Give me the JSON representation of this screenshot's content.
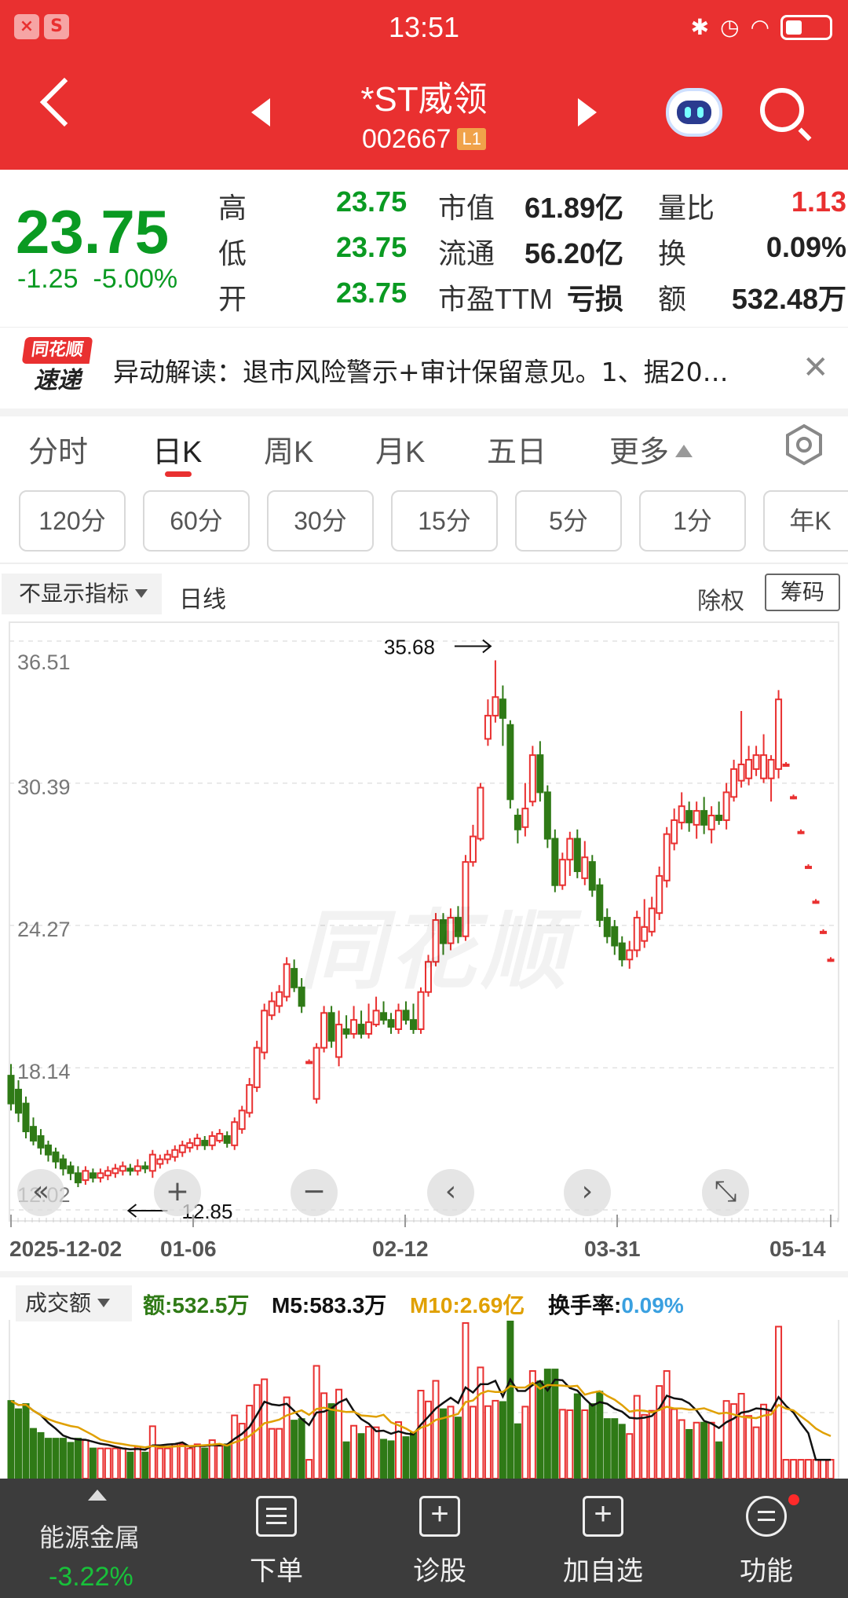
{
  "status_bar": {
    "time": "13:51"
  },
  "header": {
    "stock_name": "*ST威领",
    "stock_code": "002667",
    "level_badge": "L1"
  },
  "quote": {
    "price": "23.75",
    "change_abs": "-1.25",
    "change_pct": "-5.00%",
    "rows": [
      {
        "l1": "高",
        "v1": "23.75",
        "l2": "市值",
        "v2": "61.89亿",
        "l3": "量比",
        "v3": "1.13"
      },
      {
        "l1": "低",
        "v1": "23.75",
        "l2": "流通",
        "v2": "56.20亿",
        "l3": "换",
        "v3": "0.09%"
      },
      {
        "l1": "开",
        "v1": "23.75",
        "l2": "市盈TTM",
        "v2": "亏损",
        "l3": "额",
        "v3": "532.48万"
      }
    ]
  },
  "news": {
    "logo_top": "同花顺",
    "logo_bottom": "速递",
    "text": "异动解读：退市风险警示+审计保留意见。1、据20…"
  },
  "tabs": [
    {
      "label": "分时"
    },
    {
      "label": "日K"
    },
    {
      "label": "周K"
    },
    {
      "label": "月K"
    },
    {
      "label": "五日"
    },
    {
      "label": "更多"
    }
  ],
  "periods": [
    "120分",
    "60分",
    "30分",
    "15分",
    "5分",
    "1分",
    "年K"
  ],
  "chart_header": {
    "indicator": "不显示指标",
    "line_type": "日线",
    "adjust": "除权",
    "chips": "筹码"
  },
  "chart_data": {
    "type": "candlestick",
    "y_axis_labels": [
      "36.51",
      "30.39",
      "24.27",
      "18.14",
      "12.02"
    ],
    "ylim": [
      12.02,
      36.51
    ],
    "max_marker": "35.68",
    "min_marker": "12.85",
    "x_tick_labels": [
      "2025-12-02",
      "01-06",
      "02-12",
      "03-31",
      "05-14"
    ],
    "candles": [
      {
        "o": 17.8,
        "c": 16.6,
        "h": 18.3,
        "l": 16.3
      },
      {
        "o": 17.2,
        "c": 16.2,
        "h": 17.6,
        "l": 15.8
      },
      {
        "o": 16.6,
        "c": 15.4,
        "h": 16.9,
        "l": 15.1
      },
      {
        "o": 15.6,
        "c": 15.0,
        "h": 16.0,
        "l": 14.8
      },
      {
        "o": 15.2,
        "c": 14.7,
        "h": 15.5,
        "l": 14.4
      },
      {
        "o": 14.8,
        "c": 14.4,
        "h": 15.0,
        "l": 14.1
      },
      {
        "o": 14.5,
        "c": 14.1,
        "h": 14.7,
        "l": 13.8
      },
      {
        "o": 14.2,
        "c": 13.8,
        "h": 14.4,
        "l": 13.5
      },
      {
        "o": 13.9,
        "c": 13.6,
        "h": 14.1,
        "l": 13.3
      },
      {
        "o": 13.6,
        "c": 13.2,
        "h": 13.9,
        "l": 13.0
      },
      {
        "o": 13.3,
        "c": 13.7,
        "h": 13.9,
        "l": 13.1
      },
      {
        "o": 13.6,
        "c": 13.4,
        "h": 13.8,
        "l": 13.2
      },
      {
        "o": 13.4,
        "c": 13.6,
        "h": 13.8,
        "l": 13.2
      },
      {
        "o": 13.5,
        "c": 13.7,
        "h": 13.9,
        "l": 13.3
      },
      {
        "o": 13.6,
        "c": 13.8,
        "h": 14.0,
        "l": 13.4
      },
      {
        "o": 13.7,
        "c": 13.9,
        "h": 14.1,
        "l": 13.5
      },
      {
        "o": 13.8,
        "c": 13.7,
        "h": 14.0,
        "l": 13.5
      },
      {
        "o": 13.7,
        "c": 13.9,
        "h": 14.2,
        "l": 13.5
      },
      {
        "o": 13.9,
        "c": 13.8,
        "h": 14.1,
        "l": 13.6
      },
      {
        "o": 13.7,
        "c": 14.4,
        "h": 14.6,
        "l": 13.4
      },
      {
        "o": 14.0,
        "c": 14.2,
        "h": 14.4,
        "l": 13.8
      },
      {
        "o": 14.2,
        "c": 14.4,
        "h": 14.6,
        "l": 14.0
      },
      {
        "o": 14.3,
        "c": 14.6,
        "h": 14.8,
        "l": 14.1
      },
      {
        "o": 14.5,
        "c": 14.8,
        "h": 15.0,
        "l": 14.3
      },
      {
        "o": 14.7,
        "c": 14.9,
        "h": 15.1,
        "l": 14.5
      },
      {
        "o": 14.8,
        "c": 15.1,
        "h": 15.3,
        "l": 14.6
      },
      {
        "o": 15.0,
        "c": 14.8,
        "h": 15.2,
        "l": 14.6
      },
      {
        "o": 14.8,
        "c": 15.2,
        "h": 15.4,
        "l": 14.6
      },
      {
        "o": 15.0,
        "c": 15.3,
        "h": 15.5,
        "l": 14.9
      },
      {
        "o": 15.2,
        "c": 14.9,
        "h": 15.4,
        "l": 14.7
      },
      {
        "o": 14.8,
        "c": 15.8,
        "h": 16.0,
        "l": 14.6
      },
      {
        "o": 15.5,
        "c": 16.3,
        "h": 16.5,
        "l": 15.3
      },
      {
        "o": 16.2,
        "c": 17.4,
        "h": 17.7,
        "l": 16.0
      },
      {
        "o": 17.3,
        "c": 19.0,
        "h": 19.3,
        "l": 17.1
      },
      {
        "o": 18.8,
        "c": 20.6,
        "h": 20.9,
        "l": 18.5
      },
      {
        "o": 20.4,
        "c": 21.0,
        "h": 21.4,
        "l": 20.2
      },
      {
        "o": 20.8,
        "c": 21.4,
        "h": 21.7,
        "l": 20.5
      },
      {
        "o": 21.2,
        "c": 22.6,
        "h": 22.9,
        "l": 21.0
      },
      {
        "o": 22.4,
        "c": 21.6,
        "h": 22.8,
        "l": 21.4
      },
      {
        "o": 21.6,
        "c": 20.8,
        "h": 22.0,
        "l": 20.5
      },
      {
        "o": 18.4,
        "c": 18.4,
        "h": 18.5,
        "l": 18.3
      },
      {
        "o": 16.8,
        "c": 19.0,
        "h": 19.2,
        "l": 16.6
      },
      {
        "o": 19.0,
        "c": 20.5,
        "h": 20.8,
        "l": 18.8
      },
      {
        "o": 20.5,
        "c": 19.3,
        "h": 20.8,
        "l": 19.0
      },
      {
        "o": 18.6,
        "c": 20.0,
        "h": 20.6,
        "l": 18.2
      },
      {
        "o": 19.8,
        "c": 19.6,
        "h": 20.4,
        "l": 19.4
      },
      {
        "o": 19.6,
        "c": 20.2,
        "h": 20.8,
        "l": 19.4
      },
      {
        "o": 20.0,
        "c": 19.6,
        "h": 20.6,
        "l": 19.4
      },
      {
        "o": 19.6,
        "c": 20.1,
        "h": 20.9,
        "l": 19.4
      },
      {
        "o": 20.0,
        "c": 20.6,
        "h": 21.2,
        "l": 19.9
      },
      {
        "o": 20.5,
        "c": 20.2,
        "h": 21.0,
        "l": 20.0
      },
      {
        "o": 20.2,
        "c": 19.9,
        "h": 20.5,
        "l": 19.6
      },
      {
        "o": 19.8,
        "c": 20.6,
        "h": 20.9,
        "l": 19.6
      },
      {
        "o": 20.6,
        "c": 20.2,
        "h": 21.0,
        "l": 20.0
      },
      {
        "o": 20.2,
        "c": 19.8,
        "h": 20.9,
        "l": 19.6
      },
      {
        "o": 19.8,
        "c": 21.4,
        "h": 21.6,
        "l": 19.6
      },
      {
        "o": 21.4,
        "c": 22.7,
        "h": 23.0,
        "l": 21.2
      },
      {
        "o": 22.7,
        "c": 24.5,
        "h": 24.8,
        "l": 22.5
      },
      {
        "o": 24.5,
        "c": 23.5,
        "h": 24.8,
        "l": 23.0
      },
      {
        "o": 23.5,
        "c": 24.6,
        "h": 25.0,
        "l": 23.2
      },
      {
        "o": 24.6,
        "c": 23.8,
        "h": 25.1,
        "l": 23.5
      },
      {
        "o": 23.8,
        "c": 27.0,
        "h": 27.3,
        "l": 23.6
      },
      {
        "o": 27.0,
        "c": 28.1,
        "h": 28.6,
        "l": 26.8
      },
      {
        "o": 28.0,
        "c": 30.2,
        "h": 30.4,
        "l": 27.9
      },
      {
        "o": 32.3,
        "c": 33.3,
        "h": 34.0,
        "l": 32.0
      },
      {
        "o": 33.3,
        "c": 34.1,
        "h": 35.68,
        "l": 33.0
      },
      {
        "o": 34.0,
        "c": 33.2,
        "h": 34.6,
        "l": 32.0
      },
      {
        "o": 32.9,
        "c": 29.7,
        "h": 33.1,
        "l": 29.3
      },
      {
        "o": 29.0,
        "c": 28.4,
        "h": 29.3,
        "l": 27.8
      },
      {
        "o": 28.5,
        "c": 29.3,
        "h": 30.4,
        "l": 28.1
      },
      {
        "o": 29.6,
        "c": 31.6,
        "h": 32.0,
        "l": 29.4
      },
      {
        "o": 31.6,
        "c": 30.0,
        "h": 32.2,
        "l": 29.6
      },
      {
        "o": 30.0,
        "c": 28.0,
        "h": 30.3,
        "l": 27.6
      },
      {
        "o": 28.0,
        "c": 26.0,
        "h": 28.4,
        "l": 25.7
      },
      {
        "o": 26.0,
        "c": 27.1,
        "h": 27.4,
        "l": 25.8
      },
      {
        "o": 27.1,
        "c": 28.0,
        "h": 28.3,
        "l": 26.4
      },
      {
        "o": 28.0,
        "c": 26.6,
        "h": 28.4,
        "l": 26.3
      },
      {
        "o": 26.3,
        "c": 27.2,
        "h": 27.9,
        "l": 26.0
      },
      {
        "o": 27.0,
        "c": 25.8,
        "h": 27.3,
        "l": 25.5
      },
      {
        "o": 26.0,
        "c": 24.5,
        "h": 26.3,
        "l": 24.2
      },
      {
        "o": 24.6,
        "c": 23.8,
        "h": 25.0,
        "l": 23.5
      },
      {
        "o": 24.2,
        "c": 23.4,
        "h": 24.5,
        "l": 23.0
      },
      {
        "o": 23.5,
        "c": 22.8,
        "h": 23.8,
        "l": 22.5
      },
      {
        "o": 22.8,
        "c": 23.2,
        "h": 23.6,
        "l": 22.4
      },
      {
        "o": 23.2,
        "c": 24.6,
        "h": 24.9,
        "l": 22.9
      },
      {
        "o": 23.6,
        "c": 24.2,
        "h": 25.4,
        "l": 23.3
      },
      {
        "o": 24.0,
        "c": 25.0,
        "h": 25.5,
        "l": 23.8
      },
      {
        "o": 24.8,
        "c": 26.4,
        "h": 26.8,
        "l": 24.5
      },
      {
        "o": 26.2,
        "c": 28.2,
        "h": 28.5,
        "l": 25.9
      },
      {
        "o": 27.8,
        "c": 28.8,
        "h": 29.3,
        "l": 27.5
      },
      {
        "o": 28.7,
        "c": 29.4,
        "h": 30.0,
        "l": 28.4
      },
      {
        "o": 29.2,
        "c": 28.7,
        "h": 29.6,
        "l": 28.3
      },
      {
        "o": 28.6,
        "c": 29.2,
        "h": 29.6,
        "l": 28.0
      },
      {
        "o": 29.2,
        "c": 28.6,
        "h": 29.8,
        "l": 28.2
      },
      {
        "o": 28.4,
        "c": 29.0,
        "h": 29.4,
        "l": 27.8
      },
      {
        "o": 29.0,
        "c": 28.8,
        "h": 29.6,
        "l": 28.6
      },
      {
        "o": 28.8,
        "c": 30.0,
        "h": 30.4,
        "l": 28.4
      },
      {
        "o": 29.8,
        "c": 31.0,
        "h": 31.4,
        "l": 29.6
      },
      {
        "o": 30.5,
        "c": 31.2,
        "h": 33.5,
        "l": 30.2
      },
      {
        "o": 30.6,
        "c": 31.4,
        "h": 32.0,
        "l": 30.3
      },
      {
        "o": 31.0,
        "c": 31.6,
        "h": 32.0,
        "l": 30.7
      },
      {
        "o": 30.6,
        "c": 31.6,
        "h": 32.5,
        "l": 30.4
      },
      {
        "o": 30.6,
        "c": 31.4,
        "h": 31.6,
        "l": 29.6
      },
      {
        "o": 31.0,
        "c": 34.0,
        "h": 34.4,
        "l": 30.6
      },
      {
        "o": 31.2,
        "c": 31.2,
        "h": 31.3,
        "l": 31.1
      },
      {
        "o": 29.8,
        "c": 29.8,
        "h": 29.9,
        "l": 29.7
      },
      {
        "o": 28.3,
        "c": 28.3,
        "h": 28.4,
        "l": 28.2
      },
      {
        "o": 26.8,
        "c": 26.8,
        "h": 26.9,
        "l": 26.7
      },
      {
        "o": 25.3,
        "c": 25.3,
        "h": 25.4,
        "l": 25.2
      },
      {
        "o": 24.0,
        "c": 24.0,
        "h": 24.1,
        "l": 23.9
      },
      {
        "o": 22.8,
        "c": 22.8,
        "h": 22.9,
        "l": 22.7
      }
    ]
  },
  "controls": {
    "rewind": "«",
    "plus": "+",
    "minus": "−",
    "prev": "‹",
    "next": "›",
    "expand": "⤡"
  },
  "volume": {
    "selector": "成交额",
    "amount": "额:532.5万",
    "m5": "M5:583.3万",
    "m10": "M10:2.69亿",
    "turnover_label": "换手率:",
    "turnover_value": "0.09%",
    "colors": {
      "amount": "#2f7a16",
      "m5": "#111111",
      "m10": "#e0a000",
      "turnover": "#3aa0e0"
    }
  },
  "bottom_bar": {
    "sector_name": "能源金属",
    "sector_change": "-3.22%",
    "items": [
      {
        "label": "下单",
        "icon": "order-icon"
      },
      {
        "label": "诊股",
        "icon": "diagnose-icon"
      },
      {
        "label": "加自选",
        "icon": "add-watchlist-icon"
      },
      {
        "label": "功能",
        "icon": "menu-icon"
      }
    ]
  },
  "colors": {
    "up": "#e93030",
    "down": "#2f7a16",
    "header_bg": "#e93030"
  }
}
